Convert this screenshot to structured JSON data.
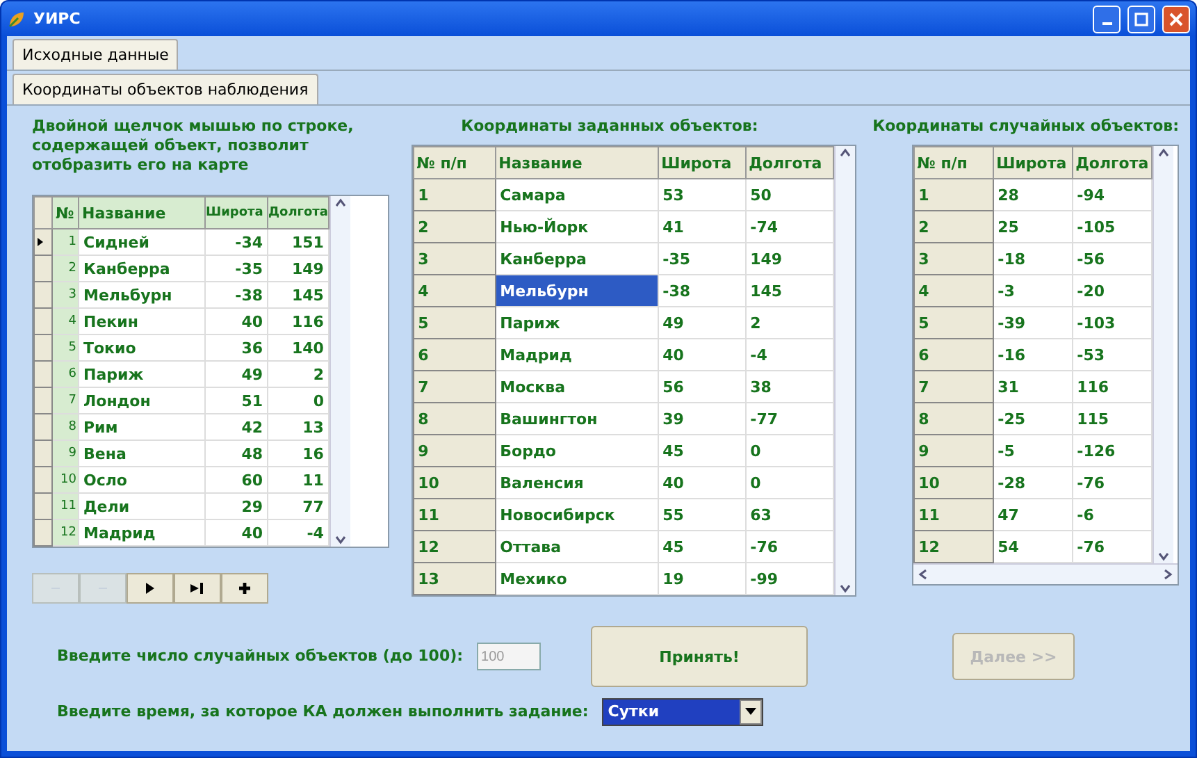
{
  "window": {
    "title": "УИРС"
  },
  "tabs": [
    {
      "label": "Исходные данные",
      "selected": true
    }
  ],
  "subtabs": [
    {
      "label": "Координаты объектов наблюдения",
      "selected": true
    }
  ],
  "hint": "Двойной щелчок мышью по строке, содержащей объект, позволит отобразить его на карте",
  "left_table": {
    "columns": [
      "№",
      "Название",
      "Широта",
      "Долгота"
    ],
    "rows": [
      {
        "cells": [
          "1",
          "Сидней",
          "-34",
          "151"
        ],
        "selected": true
      },
      {
        "cells": [
          "2",
          "Канберра",
          "-35",
          "149"
        ],
        "selected": false
      },
      {
        "cells": [
          "3",
          "Мельбурн",
          "-38",
          "145"
        ],
        "selected": false
      },
      {
        "cells": [
          "4",
          "Пекин",
          "40",
          "116"
        ],
        "selected": false
      },
      {
        "cells": [
          "5",
          "Токио",
          "36",
          "140"
        ],
        "selected": false
      },
      {
        "cells": [
          "6",
          "Париж",
          "49",
          "2"
        ],
        "selected": false
      },
      {
        "cells": [
          "7",
          "Лондон",
          "51",
          "0"
        ],
        "selected": false
      },
      {
        "cells": [
          "8",
          "Рим",
          "42",
          "13"
        ],
        "selected": false
      },
      {
        "cells": [
          "9",
          "Вена",
          "48",
          "16"
        ],
        "selected": false
      },
      {
        "cells": [
          "10",
          "Осло",
          "60",
          "11"
        ],
        "selected": false
      },
      {
        "cells": [
          "11",
          "Дели",
          "29",
          "77"
        ],
        "selected": false
      },
      {
        "cells": [
          "12",
          "Мадрид",
          "40",
          "-4"
        ],
        "selected": false
      }
    ]
  },
  "navigator": [
    {
      "kind": "first",
      "disabled": true
    },
    {
      "kind": "prior",
      "disabled": true
    },
    {
      "kind": "next",
      "disabled": false
    },
    {
      "kind": "last",
      "disabled": false
    },
    {
      "kind": "add",
      "disabled": false
    }
  ],
  "given_title": "Координаты заданных объектов:",
  "given_table": {
    "columns": [
      "№ п/п",
      "Название",
      "Широта",
      "Долгота"
    ],
    "rows": [
      {
        "cells": [
          "1",
          "Самара",
          "53",
          "50"
        ],
        "selected": false
      },
      {
        "cells": [
          "2",
          "Нью-Йорк",
          "41",
          "-74"
        ],
        "selected": false
      },
      {
        "cells": [
          "3",
          "Канберра",
          "-35",
          "149"
        ],
        "selected": false
      },
      {
        "cells": [
          "4",
          "Мельбурн",
          "-38",
          "145"
        ],
        "selected": true
      },
      {
        "cells": [
          "5",
          "Париж",
          "49",
          "2"
        ],
        "selected": false
      },
      {
        "cells": [
          "6",
          "Мадрид",
          "40",
          "-4"
        ],
        "selected": false
      },
      {
        "cells": [
          "7",
          "Москва",
          "56",
          "38"
        ],
        "selected": false
      },
      {
        "cells": [
          "8",
          "Вашингтон",
          "39",
          "-77"
        ],
        "selected": false
      },
      {
        "cells": [
          "9",
          "Бордо",
          "45",
          "0"
        ],
        "selected": false
      },
      {
        "cells": [
          "10",
          "Валенсия",
          "40",
          "0"
        ],
        "selected": false
      },
      {
        "cells": [
          "11",
          "Новосибирск",
          "55",
          "63"
        ],
        "selected": false
      },
      {
        "cells": [
          "12",
          "Оттава",
          "45",
          "-76"
        ],
        "selected": false
      },
      {
        "cells": [
          "13",
          "Мехико",
          "19",
          "-99"
        ],
        "selected": false
      }
    ]
  },
  "random_title": "Координаты случайных объектов:",
  "random_table": {
    "columns": [
      "№ п/п",
      "Широта",
      "Долгота"
    ],
    "rows": [
      {
        "cells": [
          "1",
          "28",
          "-94"
        ]
      },
      {
        "cells": [
          "2",
          "25",
          "-105"
        ]
      },
      {
        "cells": [
          "3",
          "-18",
          "-56"
        ]
      },
      {
        "cells": [
          "4",
          "-3",
          "-20"
        ]
      },
      {
        "cells": [
          "5",
          "-39",
          "-103"
        ]
      },
      {
        "cells": [
          "6",
          "-16",
          "-53"
        ]
      },
      {
        "cells": [
          "7",
          "31",
          "116"
        ]
      },
      {
        "cells": [
          "8",
          "-25",
          "115"
        ]
      },
      {
        "cells": [
          "9",
          "-5",
          "-126"
        ]
      },
      {
        "cells": [
          "10",
          "-28",
          "-76"
        ]
      },
      {
        "cells": [
          "11",
          "47",
          "-6"
        ]
      },
      {
        "cells": [
          "12",
          "54",
          "-76"
        ]
      }
    ]
  },
  "count": {
    "label": "Введите число случайных объектов  (до 100):",
    "value": "100",
    "disabled": true
  },
  "accept_button": {
    "label": "Принять!",
    "disabled": false
  },
  "next_button": {
    "label": "Далее >>",
    "disabled": true
  },
  "time": {
    "label": "Введите время, за которое КА должен выполнить задание:",
    "value": "Сутки"
  }
}
